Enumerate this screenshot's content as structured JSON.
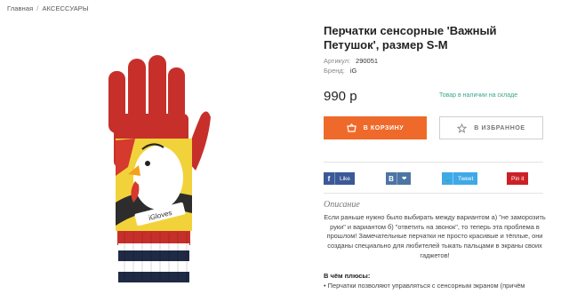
{
  "breadcrumb": {
    "home": "Главная",
    "separator": "/",
    "category": "АКСЕССУАРЫ"
  },
  "product": {
    "title": "Перчатки сенсорные 'Важный Петушок', размер S-M",
    "sku_label": "Артикул:",
    "sku": "290051",
    "brand_label": "Бренд:",
    "brand": "iG",
    "price": "990 р",
    "stock": "Товар в наличии на складе",
    "glove_print_text": "iGloves"
  },
  "actions": {
    "cart_label": "В КОРЗИНУ",
    "favorites_label": "В ИЗБРАННОЕ"
  },
  "share": [
    {
      "name": "facebook",
      "icon": "f",
      "label": "Like"
    },
    {
      "name": "vk",
      "icon": "B",
      "label": "❤"
    },
    {
      "name": "twitter",
      "icon": "🐦",
      "label": "Tweet"
    },
    {
      "name": "pinterest",
      "icon": "",
      "label": "Pin it"
    }
  ],
  "description": {
    "heading": "Описание",
    "text": "Если раньше нужно было выбирать между вариантом а) \"не заморозить руки\" и вариантом б) \"ответить на звонок\", то теперь эта проблема в прошлом! Замечательные перчатки не просто красивые и тёплые, они созданы специально для любителей тыкать пальцами в экраны своих гаджетов!",
    "plus_heading": "В чём плюсы:",
    "plus_items": [
      "• Перчатки позволяют управляться с сенсорным экраном (причём"
    ]
  },
  "colors": {
    "accent": "#ef6a2a",
    "stock": "#3aa58a"
  }
}
